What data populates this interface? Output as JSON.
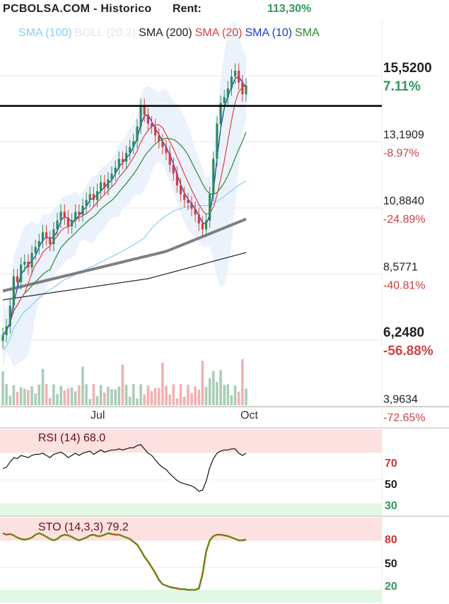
{
  "header": {
    "title": "PCBOLSA.COM - Historico",
    "rent_label": "Rent:",
    "rent_value": "113,30%"
  },
  "legend": [
    {
      "label": "SMA (100)",
      "color": "#87cefa"
    },
    {
      "label": "BOLL (20,2)",
      "color": "#dde6f2"
    },
    {
      "label": "SMA (200)",
      "color": "#222222"
    },
    {
      "label": "SMA (20)",
      "color": "#e04040"
    },
    {
      "label": "SMA (10)",
      "color": "#1e3ccc"
    },
    {
      "label": "SMA",
      "color": "#2a8a2a"
    }
  ],
  "price_axis": [
    {
      "price": "15,5200",
      "pct": "7.11%",
      "pct_color": "#2e9a5a",
      "bold": true
    },
    {
      "price": "13,1909",
      "pct": "-8.97%",
      "pct_color": "#cc4444",
      "bold": false
    },
    {
      "price": "10,8840",
      "pct": "-24.89%",
      "pct_color": "#cc4444",
      "bold": false
    },
    {
      "price": "8,5771",
      "pct": "-40.81%",
      "pct_color": "#cc4444",
      "bold": false
    },
    {
      "price": "6,2480",
      "pct": "-56.88%",
      "pct_color": "#cc4444",
      "bold": true
    },
    {
      "price": "3,9634",
      "pct": "-72.65%",
      "pct_color": "#cc4444",
      "bold": false
    }
  ],
  "x_labels": [
    "Jul",
    "Oct"
  ],
  "rsi": {
    "title": "RSI (14) 68.0",
    "levels": [
      "70",
      "50",
      "30"
    ]
  },
  "sto": {
    "title": "STO (14,3,3) 79.2",
    "levels": [
      "80",
      "50",
      "20"
    ]
  },
  "chart_data": {
    "type": "candlestick",
    "y_range": [
      3.9634,
      15.52
    ],
    "support_line": 14.2,
    "close_approx": [
      6.4,
      6.7,
      7.4,
      8.4,
      8.2,
      8.8,
      8.9,
      8.7,
      9.2,
      9.4,
      9.6,
      9.9,
      9.7,
      9.5,
      10.0,
      10.3,
      10.6,
      10.4,
      10.1,
      10.3,
      10.6,
      10.5,
      10.8,
      11.0,
      11.2,
      11.0,
      11.3,
      11.6,
      11.4,
      11.7,
      11.9,
      12.1,
      12.4,
      12.3,
      12.6,
      12.8,
      13.0,
      13.5,
      14.2,
      13.9,
      13.6,
      13.5,
      13.2,
      13.0,
      12.8,
      12.6,
      12.2,
      11.9,
      11.5,
      11.2,
      11.0,
      10.9,
      10.7,
      10.5,
      10.2,
      10.0,
      10.3,
      11.2,
      12.4,
      13.6,
      14.3,
      14.5,
      14.8,
      15.2,
      15.4,
      15.0,
      14.6,
      14.9
    ],
    "rsi_14": [
      54,
      55,
      60,
      64,
      63,
      66,
      65,
      64,
      66,
      67,
      67,
      68,
      66,
      64,
      67,
      68,
      69,
      67,
      64,
      66,
      68,
      66,
      68,
      69,
      70,
      67,
      69,
      71,
      69,
      70,
      71,
      71,
      72,
      71,
      72,
      73,
      73,
      75,
      76,
      72,
      68,
      66,
      62,
      58,
      55,
      53,
      49,
      46,
      43,
      41,
      40,
      39,
      38,
      36,
      33,
      34,
      42,
      55,
      63,
      68,
      70,
      71,
      71,
      72,
      72,
      68,
      66,
      68
    ],
    "sto_14_3_3": [
      88,
      86,
      87,
      85,
      82,
      80,
      79,
      80,
      82,
      86,
      88,
      86,
      83,
      80,
      78,
      80,
      84,
      86,
      85,
      83,
      80,
      78,
      80,
      82,
      85,
      86,
      84,
      84,
      86,
      88,
      87,
      86,
      86,
      84,
      82,
      80,
      76,
      72,
      64,
      55,
      48,
      40,
      32,
      22,
      16,
      14,
      12,
      11,
      10,
      9,
      9,
      8,
      8,
      8,
      10,
      30,
      62,
      78,
      84,
      86,
      86,
      85,
      84,
      82,
      80,
      78,
      78,
      79
    ]
  }
}
